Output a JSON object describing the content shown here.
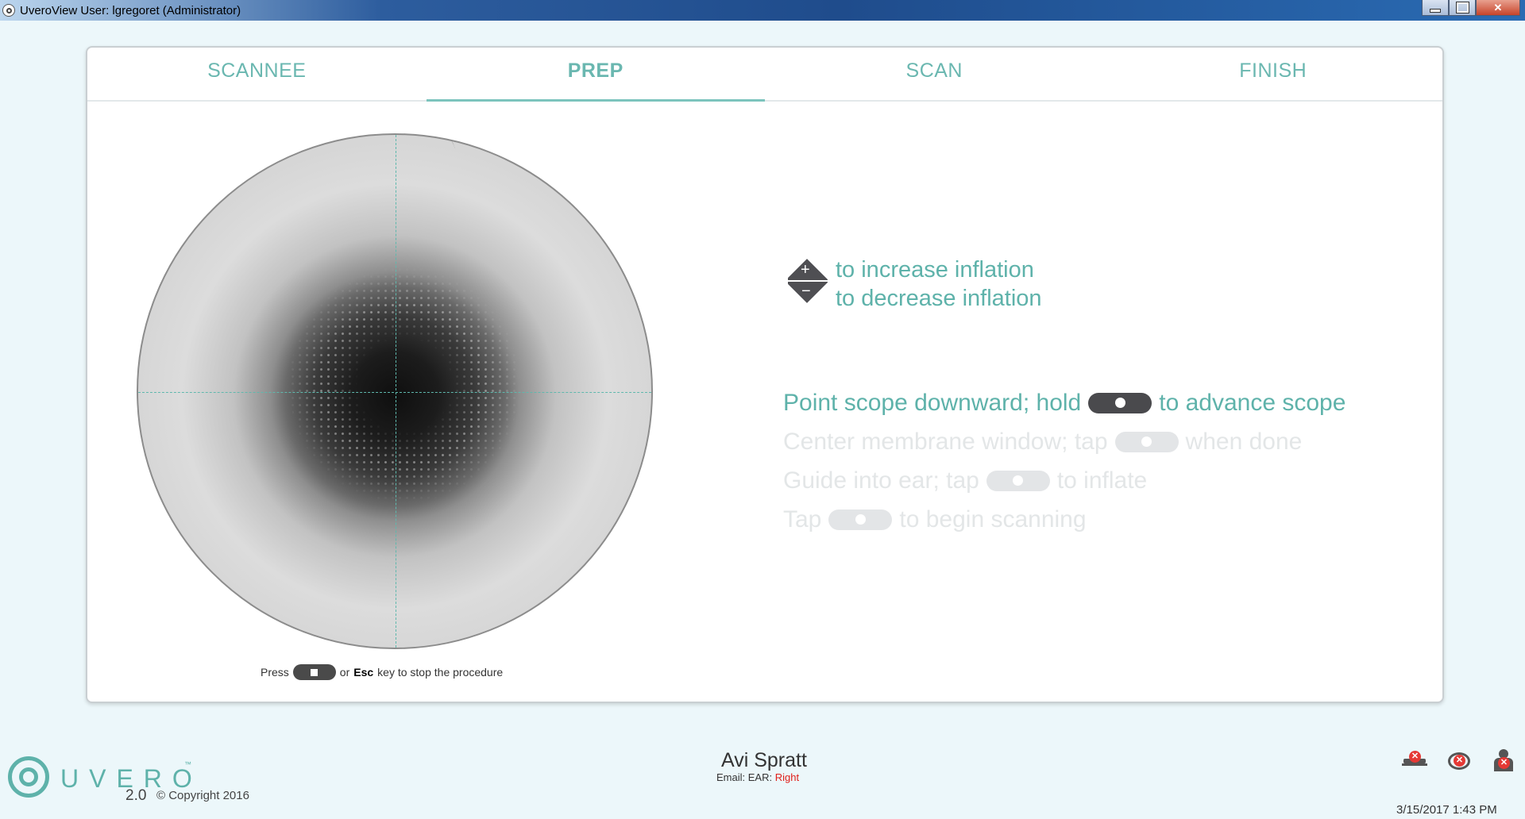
{
  "window": {
    "title": "UveroView User: lgregoret (Administrator)",
    "controls": [
      "minimize",
      "maximize",
      "close"
    ],
    "close_glyph": "✕"
  },
  "tabs": [
    {
      "label": "SCANNEE",
      "active": false
    },
    {
      "label": "PREP",
      "active": true
    },
    {
      "label": "SCAN",
      "active": false
    },
    {
      "label": "FINISH",
      "active": false
    }
  ],
  "inflation": {
    "icon": "inflation-up-down-icon",
    "plus_glyph": "+",
    "minus_glyph": "−",
    "increase": "to increase inflation",
    "decrease": "to decrease inflation"
  },
  "steps": [
    {
      "before": "Point scope downward; hold",
      "after": "to advance scope",
      "active": true
    },
    {
      "before": "Center membrane window; tap",
      "after": "when done",
      "active": false
    },
    {
      "before": "Guide into ear; tap",
      "after": "to inflate",
      "active": false
    },
    {
      "before": "Tap",
      "after": "to begin scanning",
      "active": false
    }
  ],
  "stop_hint": {
    "press": "Press",
    "or": "or",
    "key": "Esc",
    "rest": "key to stop the procedure"
  },
  "logo": {
    "word": "UVERO",
    "tm": "™",
    "version": "2.0",
    "copyright": "© Copyright 2016"
  },
  "patient": {
    "name": "Avi Spratt",
    "email_label": "Email:",
    "ear_label": "EAR:",
    "ear_value": "Right"
  },
  "status_icons": [
    "device-disconnected-icon",
    "connection-error-icon",
    "user-error-icon"
  ],
  "status_x_glyph": "✕",
  "timestamp": "3/15/2017 1:43 PM",
  "colors": {
    "accent": "#5eb2aa",
    "inactive_text": "#e3e6e7",
    "active_pill": "#4a4a4d",
    "error": "#e53935"
  }
}
